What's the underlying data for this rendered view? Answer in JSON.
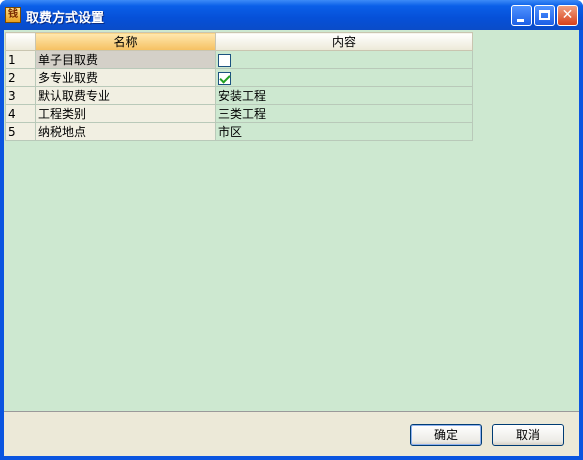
{
  "window": {
    "title": "取费方式设置",
    "icon": "app-icon",
    "controls": [
      "minimize-button",
      "maximize-button",
      "close-button"
    ]
  },
  "grid": {
    "columns": {
      "rownum": "",
      "name": "名称",
      "value": "内容"
    },
    "rows": [
      {
        "num": "1",
        "name": "单子目取费",
        "type": "checkbox",
        "checked": false,
        "value": ""
      },
      {
        "num": "2",
        "name": "多专业取费",
        "type": "checkbox",
        "checked": true,
        "value": ""
      },
      {
        "num": "3",
        "name": "默认取费专业",
        "type": "text",
        "value": "安装工程"
      },
      {
        "num": "4",
        "name": "工程类别",
        "type": "text",
        "value": "三类工程"
      },
      {
        "num": "5",
        "name": "纳税地点",
        "type": "text",
        "value": "市区"
      }
    ]
  },
  "buttons": {
    "ok": "确定",
    "cancel": "取消"
  },
  "colors": {
    "grid_background": "#cde8d0",
    "titlebar": "#0650d8",
    "header_highlight": "#f5c060"
  }
}
